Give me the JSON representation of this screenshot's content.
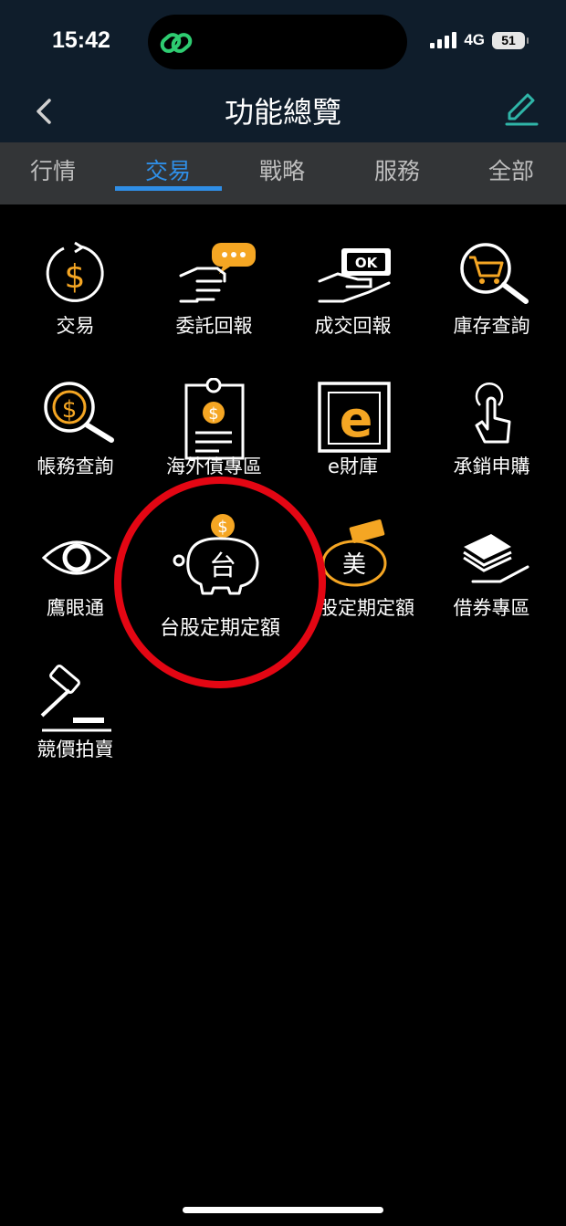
{
  "status": {
    "time": "15:42",
    "network": "4G",
    "battery": "51"
  },
  "header": {
    "title": "功能總覽"
  },
  "tabs": [
    {
      "label": "行情",
      "active": false
    },
    {
      "label": "交易",
      "active": true
    },
    {
      "label": "戰略",
      "active": false
    },
    {
      "label": "服務",
      "active": false
    },
    {
      "label": "全部",
      "active": false
    }
  ],
  "grid": {
    "items": [
      {
        "label": "交易",
        "icon": "dollar-refresh-icon"
      },
      {
        "label": "委託回報",
        "icon": "hand-chat-icon"
      },
      {
        "label": "成交回報",
        "icon": "hand-ok-icon"
      },
      {
        "label": "庫存查詢",
        "icon": "cart-search-icon"
      },
      {
        "label": "帳務查詢",
        "icon": "magnifier-dollar-icon"
      },
      {
        "label": "海外債專區",
        "icon": "bond-document-icon"
      },
      {
        "label": "e財庫",
        "icon": "e-vault-icon"
      },
      {
        "label": "承銷申購",
        "icon": "tap-finger-icon"
      },
      {
        "label": "鷹眼通",
        "icon": "eye-icon"
      },
      {
        "label": "台股定期定額",
        "icon": "piggy-tw-icon"
      },
      {
        "label": "股定期定額",
        "icon": "piggy-us-icon"
      },
      {
        "label": "借券專區",
        "icon": "cash-stack-hand-icon"
      },
      {
        "label": "競價拍賣",
        "icon": "gavel-icon"
      }
    ]
  },
  "highlight": {
    "label": "台股定期定額",
    "glyph": "台",
    "color": "#e30613"
  },
  "us_piggy_glyph": "美",
  "colors": {
    "accent": "#2f8ee6",
    "icon_orange": "#f5a623",
    "header_bg": "#0f1d2b"
  }
}
